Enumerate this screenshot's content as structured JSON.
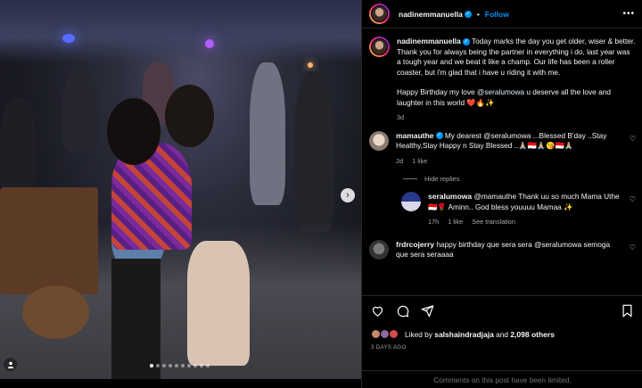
{
  "post": {
    "carousel": {
      "slide_count": 10,
      "active_index": 0
    }
  },
  "header": {
    "username": "nadinemmanuella",
    "separator": "•",
    "follow_label": "Follow",
    "more_label": "•••"
  },
  "caption": {
    "username": "nadinemmanuella",
    "text_1": "Today marks the day you get older, wiser & better. Thank you for always being the partner in everything i do, last year was a tough year and we beat it like a champ. Our life has been a roller coaster, but i'm glad that i have u riding it with me.",
    "text_2_prefix": "Happy Birthday my love ",
    "text_2_mention": "@seralumowa",
    "text_2_suffix": " u deserve all the love and laughter in this world ❤️🔥✨",
    "age": "3d"
  },
  "comments": [
    {
      "username": "mamauthe",
      "text": "My dearest @seralumowa ...Blessed B'day ..Stay Healthy,Stay Happy n Stay Blessed ..🙏🏼🇮🇩🙏🏼😘🇮🇩🙏🏼",
      "age": "2d",
      "likes": "1 like"
    }
  ],
  "hide_replies_label": "Hide replies",
  "replies": [
    {
      "username": "seralumowa",
      "text": "@mamauthe Thank uu so much Mama Uthe 🇮🇩🌹 Aminn.. God bless youuuu Mamaa ✨",
      "age": "17h",
      "likes": "1 like",
      "translate": "See translation"
    }
  ],
  "comments_2": [
    {
      "username": "frdrcojerry",
      "text": "happy birthday que sera sera @seralumowa semoga que sera seraaaa"
    }
  ],
  "likes": {
    "prefix": "Liked by ",
    "user": "salshaindradjaja",
    "middle": " and ",
    "count": "2,098 others"
  },
  "date": "3 DAYS AGO",
  "limited_notice": "Comments on this post have been limited.",
  "icons": {
    "like": "heart-icon",
    "comment": "comment-icon",
    "share": "share-icon",
    "save": "bookmark-icon",
    "next": "chevron-right-icon",
    "tags": "user-tag-icon"
  },
  "colors": {
    "accent": "#0095f6",
    "background": "#000000",
    "secondary_text": "#a8a8a8",
    "divider": "#262626"
  }
}
